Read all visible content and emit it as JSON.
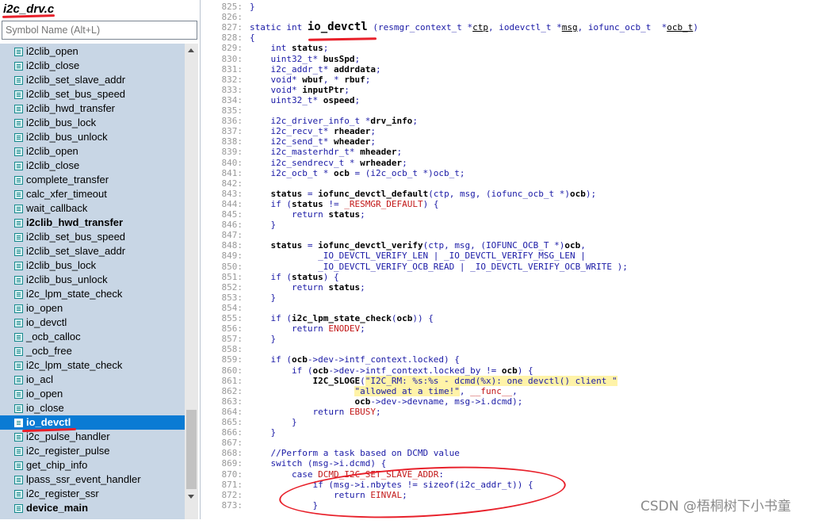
{
  "left_panel": {
    "file_title": "i2c_drv.c",
    "search_placeholder": "Symbol Name (Alt+L)",
    "symbols": [
      {
        "label": "i2clib_open",
        "bold": false,
        "selected": false
      },
      {
        "label": "i2clib_close",
        "bold": false,
        "selected": false
      },
      {
        "label": "i2clib_set_slave_addr",
        "bold": false,
        "selected": false
      },
      {
        "label": "i2clib_set_bus_speed",
        "bold": false,
        "selected": false
      },
      {
        "label": "i2clib_hwd_transfer",
        "bold": false,
        "selected": false
      },
      {
        "label": "i2clib_bus_lock",
        "bold": false,
        "selected": false
      },
      {
        "label": "i2clib_bus_unlock",
        "bold": false,
        "selected": false
      },
      {
        "label": "i2clib_open",
        "bold": false,
        "selected": false
      },
      {
        "label": "i2clib_close",
        "bold": false,
        "selected": false
      },
      {
        "label": "complete_transfer",
        "bold": false,
        "selected": false
      },
      {
        "label": "calc_xfer_timeout",
        "bold": false,
        "selected": false
      },
      {
        "label": "wait_callback",
        "bold": false,
        "selected": false
      },
      {
        "label": "i2clib_hwd_transfer",
        "bold": true,
        "selected": false
      },
      {
        "label": "i2clib_set_bus_speed",
        "bold": false,
        "selected": false
      },
      {
        "label": "i2clib_set_slave_addr",
        "bold": false,
        "selected": false
      },
      {
        "label": "i2clib_bus_lock",
        "bold": false,
        "selected": false
      },
      {
        "label": "i2clib_bus_unlock",
        "bold": false,
        "selected": false
      },
      {
        "label": "i2c_lpm_state_check",
        "bold": false,
        "selected": false
      },
      {
        "label": "io_open",
        "bold": false,
        "selected": false
      },
      {
        "label": "io_devctl",
        "bold": false,
        "selected": false
      },
      {
        "label": "_ocb_calloc",
        "bold": false,
        "selected": false
      },
      {
        "label": "_ocb_free",
        "bold": false,
        "selected": false
      },
      {
        "label": "i2c_lpm_state_check",
        "bold": false,
        "selected": false
      },
      {
        "label": "io_acl",
        "bold": false,
        "selected": false
      },
      {
        "label": "io_open",
        "bold": false,
        "selected": false
      },
      {
        "label": "io_close",
        "bold": false,
        "selected": false
      },
      {
        "label": "io_devctl",
        "bold": true,
        "selected": true
      },
      {
        "label": "i2c_pulse_handler",
        "bold": false,
        "selected": false
      },
      {
        "label": "i2c_register_pulse",
        "bold": false,
        "selected": false
      },
      {
        "label": "get_chip_info",
        "bold": false,
        "selected": false
      },
      {
        "label": "lpass_ssr_event_handler",
        "bold": false,
        "selected": false
      },
      {
        "label": "i2c_register_ssr",
        "bold": false,
        "selected": false
      },
      {
        "label": "device_main",
        "bold": true,
        "selected": false
      }
    ]
  },
  "code": {
    "lines": [
      {
        "n": "825:",
        "t": "}"
      },
      {
        "n": "826:",
        "t": ""
      },
      {
        "n": "827:",
        "t": "static int io_devctl (resmgr_context_t *ctp, iodevctl_t *msg, iofunc_ocb_t  *ocb_t)"
      },
      {
        "n": "828:",
        "t": "{"
      },
      {
        "n": "829:",
        "t": "    int status;"
      },
      {
        "n": "830:",
        "t": "    uint32_t* busSpd;"
      },
      {
        "n": "831:",
        "t": "    i2c_addr_t* addrdata;"
      },
      {
        "n": "832:",
        "t": "    void* wbuf, * rbuf;"
      },
      {
        "n": "833:",
        "t": "    void* inputPtr;"
      },
      {
        "n": "834:",
        "t": "    uint32_t* ospeed;"
      },
      {
        "n": "835:",
        "t": ""
      },
      {
        "n": "836:",
        "t": "    i2c_driver_info_t *drv_info;"
      },
      {
        "n": "837:",
        "t": "    i2c_recv_t* rheader;"
      },
      {
        "n": "838:",
        "t": "    i2c_send_t* wheader;"
      },
      {
        "n": "839:",
        "t": "    i2c_masterhdr_t* mheader;"
      },
      {
        "n": "840:",
        "t": "    i2c_sendrecv_t * wrheader;"
      },
      {
        "n": "841:",
        "t": "    i2c_ocb_t * ocb = (i2c_ocb_t *)ocb_t;"
      },
      {
        "n": "842:",
        "t": ""
      },
      {
        "n": "843:",
        "t": "    status = iofunc_devctl_default(ctp, msg, (iofunc_ocb_t *)ocb);"
      },
      {
        "n": "844:",
        "t": "    if (status != _RESMGR_DEFAULT) {"
      },
      {
        "n": "845:",
        "t": "        return status;"
      },
      {
        "n": "846:",
        "t": "    }"
      },
      {
        "n": "847:",
        "t": ""
      },
      {
        "n": "848:",
        "t": "    status = iofunc_devctl_verify(ctp, msg, (IOFUNC_OCB_T *)ocb,"
      },
      {
        "n": "849:",
        "t": "             _IO_DEVCTL_VERIFY_LEN | _IO_DEVCTL_VERIFY_MSG_LEN |"
      },
      {
        "n": "850:",
        "t": "             _IO_DEVCTL_VERIFY_OCB_READ | _IO_DEVCTL_VERIFY_OCB_WRITE );"
      },
      {
        "n": "851:",
        "t": "    if (status) {"
      },
      {
        "n": "852:",
        "t": "        return status;"
      },
      {
        "n": "853:",
        "t": "    }"
      },
      {
        "n": "854:",
        "t": ""
      },
      {
        "n": "855:",
        "t": "    if (i2c_lpm_state_check(ocb)) {"
      },
      {
        "n": "856:",
        "t": "        return ENODEV;"
      },
      {
        "n": "857:",
        "t": "    }"
      },
      {
        "n": "858:",
        "t": ""
      },
      {
        "n": "859:",
        "t": "    if (ocb->dev->intf_context.locked) {"
      },
      {
        "n": "860:",
        "t": "        if (ocb->dev->intf_context.locked_by != ocb) {"
      },
      {
        "n": "861:",
        "t": "            I2C_SLOGE(\"I2C_RM: %s:%s - dcmd(%x): one devctl() client \""
      },
      {
        "n": "862:",
        "t": "                    \"allowed at a time!\", __func__,"
      },
      {
        "n": "863:",
        "t": "                    ocb->dev->devname, msg->i.dcmd);"
      },
      {
        "n": "864:",
        "t": "            return EBUSY;"
      },
      {
        "n": "865:",
        "t": "        }"
      },
      {
        "n": "866:",
        "t": "    }"
      },
      {
        "n": "867:",
        "t": ""
      },
      {
        "n": "868:",
        "t": "    //Perform a task based on DCMD value"
      },
      {
        "n": "869:",
        "t": "    switch (msg->i.dcmd) {"
      },
      {
        "n": "870:",
        "t": "        case DCMD_I2C_SET_SLAVE_ADDR:"
      },
      {
        "n": "871:",
        "t": "            if (msg->i.nbytes != sizeof(i2c_addr_t)) {"
      },
      {
        "n": "872:",
        "t": "                return EINVAL;"
      },
      {
        "n": "873:",
        "t": "            }"
      }
    ]
  },
  "watermark": "CSDN @梧桐树下小书童",
  "colors": {
    "selection": "#0a7bd4",
    "annotation_red": "#e8202a",
    "code_blue": "#1a1aa6",
    "list_bg": "#c8d6e5"
  }
}
